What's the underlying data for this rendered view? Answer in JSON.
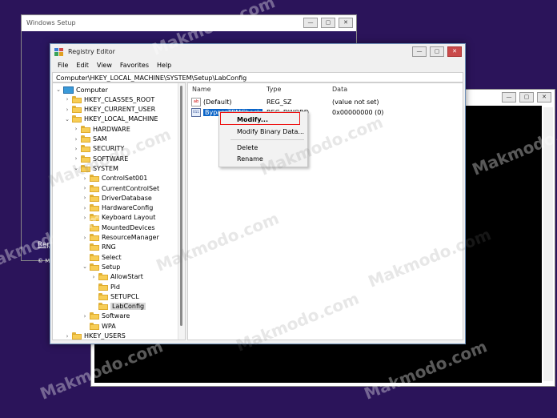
{
  "setup_window": {
    "title": "Windows Setup",
    "repair_link": "Rep",
    "copyright": "© M"
  },
  "regedit": {
    "title": "Registry Editor",
    "menu": [
      "File",
      "Edit",
      "View",
      "Favorites",
      "Help"
    ],
    "address": "Computer\\HKEY_LOCAL_MACHINE\\SYSTEM\\Setup\\LabConfig",
    "tree": [
      {
        "label": "Computer",
        "level": 0,
        "expanded": true,
        "icon": "computer-icon"
      },
      {
        "label": "HKEY_CLASSES_ROOT",
        "level": 1,
        "expanded": false
      },
      {
        "label": "HKEY_CURRENT_USER",
        "level": 1,
        "expanded": false
      },
      {
        "label": "HKEY_LOCAL_MACHINE",
        "level": 1,
        "expanded": true
      },
      {
        "label": "HARDWARE",
        "level": 2,
        "expanded": false
      },
      {
        "label": "SAM",
        "level": 2,
        "expanded": false
      },
      {
        "label": "SECURITY",
        "level": 2,
        "expanded": false
      },
      {
        "label": "SOFTWARE",
        "level": 2,
        "expanded": false
      },
      {
        "label": "SYSTEM",
        "level": 2,
        "expanded": true
      },
      {
        "label": "ControlSet001",
        "level": 3,
        "expanded": false
      },
      {
        "label": "CurrentControlSet",
        "level": 3,
        "expanded": false
      },
      {
        "label": "DriverDatabase",
        "level": 3,
        "expanded": false
      },
      {
        "label": "HardwareConfig",
        "level": 3,
        "expanded": false
      },
      {
        "label": "Keyboard Layout",
        "level": 3,
        "expanded": false
      },
      {
        "label": "MountedDevices",
        "level": 3,
        "expanded": null
      },
      {
        "label": "ResourceManager",
        "level": 3,
        "expanded": false
      },
      {
        "label": "RNG",
        "level": 3,
        "expanded": null
      },
      {
        "label": "Select",
        "level": 3,
        "expanded": null
      },
      {
        "label": "Setup",
        "level": 3,
        "expanded": true
      },
      {
        "label": "AllowStart",
        "level": 4,
        "expanded": false
      },
      {
        "label": "Pid",
        "level": 4,
        "expanded": null
      },
      {
        "label": "SETUPCL",
        "level": 4,
        "expanded": null
      },
      {
        "label": "LabConfig",
        "level": 4,
        "expanded": null,
        "selected": true
      },
      {
        "label": "Software",
        "level": 3,
        "expanded": false
      },
      {
        "label": "WPA",
        "level": 3,
        "expanded": null
      },
      {
        "label": "HKEY_USERS",
        "level": 1,
        "expanded": false
      }
    ],
    "columns": {
      "name": "Name",
      "type": "Type",
      "data": "Data"
    },
    "values": [
      {
        "name": "(Default)",
        "type": "REG_SZ",
        "data": "(value not set)",
        "icon": "string-value-icon"
      },
      {
        "name": "BypassTPMCheck",
        "type": "REG_DWORD",
        "data": "0x00000000 (0)",
        "icon": "binary-value-icon",
        "selected": true
      }
    ],
    "context_menu": [
      "Modify...",
      "Modify Binary Data...",
      "Delete",
      "Rename"
    ]
  },
  "watermark": "Makmodo.com",
  "colors": {
    "desktop": "#2b145a",
    "selection": "#0a64c8",
    "highlight_box": "#e11111"
  }
}
